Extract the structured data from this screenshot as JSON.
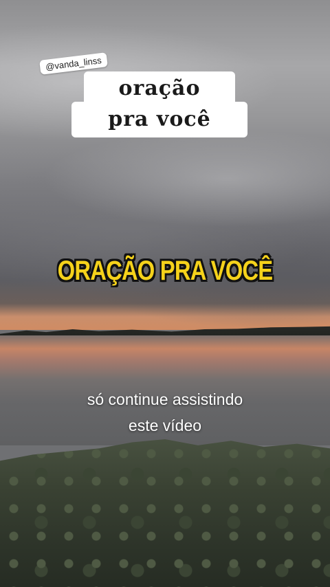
{
  "overlay": {
    "username": "@vanda_linss",
    "title_line1": "oração",
    "title_line2": "pra você",
    "caption": "ORAÇÃO PRA VOCÊ",
    "subtitle_line1": "só continue assistindo",
    "subtitle_line2": "este vídeo"
  },
  "colors": {
    "caption": "#f5d21b",
    "caption_outline": "#111111",
    "sticker_bg": "#ffffff"
  }
}
